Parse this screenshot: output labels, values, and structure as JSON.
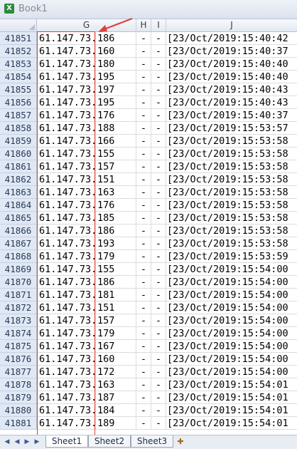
{
  "window": {
    "title": "Book1"
  },
  "columns": [
    "G",
    "H",
    "I",
    "J"
  ],
  "rows": [
    {
      "num": "41851",
      "ip": "61.147.73.",
      "oct": "186",
      "h": "-",
      "i": "-",
      "time": "[23/Oct/2019:15:40:42"
    },
    {
      "num": "41852",
      "ip": "61.147.73.",
      "oct": "160",
      "h": "-",
      "i": "-",
      "time": "[23/Oct/2019:15:40:37"
    },
    {
      "num": "41853",
      "ip": "61.147.73.",
      "oct": "180",
      "h": "-",
      "i": "-",
      "time": "[23/Oct/2019:15:40:40"
    },
    {
      "num": "41854",
      "ip": "61.147.73.",
      "oct": "195",
      "h": "-",
      "i": "-",
      "time": "[23/Oct/2019:15:40:40"
    },
    {
      "num": "41855",
      "ip": "61.147.73.",
      "oct": "197",
      "h": "-",
      "i": "-",
      "time": "[23/Oct/2019:15:40:43"
    },
    {
      "num": "41856",
      "ip": "61.147.73.",
      "oct": "195",
      "h": "-",
      "i": "-",
      "time": "[23/Oct/2019:15:40:43"
    },
    {
      "num": "41857",
      "ip": "61.147.73.",
      "oct": "176",
      "h": "-",
      "i": "-",
      "time": "[23/Oct/2019:15:40:37"
    },
    {
      "num": "41858",
      "ip": "61.147.73.",
      "oct": "188",
      "h": "-",
      "i": "-",
      "time": "[23/Oct/2019:15:53:57"
    },
    {
      "num": "41859",
      "ip": "61.147.73.",
      "oct": "166",
      "h": "-",
      "i": "-",
      "time": "[23/Oct/2019:15:53:58"
    },
    {
      "num": "41860",
      "ip": "61.147.73.",
      "oct": "155",
      "h": "-",
      "i": "-",
      "time": "[23/Oct/2019:15:53:58"
    },
    {
      "num": "41861",
      "ip": "61.147.73.",
      "oct": "157",
      "h": "-",
      "i": "-",
      "time": "[23/Oct/2019:15:53:58"
    },
    {
      "num": "41862",
      "ip": "61.147.73.",
      "oct": "151",
      "h": "-",
      "i": "-",
      "time": "[23/Oct/2019:15:53:58"
    },
    {
      "num": "41863",
      "ip": "61.147.73.",
      "oct": "163",
      "h": "-",
      "i": "-",
      "time": "[23/Oct/2019:15:53:58"
    },
    {
      "num": "41864",
      "ip": "61.147.73.",
      "oct": "176",
      "h": "-",
      "i": "-",
      "time": "[23/Oct/2019:15:53:58"
    },
    {
      "num": "41865",
      "ip": "61.147.73.",
      "oct": "185",
      "h": "-",
      "i": "-",
      "time": "[23/Oct/2019:15:53:58"
    },
    {
      "num": "41866",
      "ip": "61.147.73.",
      "oct": "186",
      "h": "-",
      "i": "-",
      "time": "[23/Oct/2019:15:53:58"
    },
    {
      "num": "41867",
      "ip": "61.147.73.",
      "oct": "193",
      "h": "-",
      "i": "-",
      "time": "[23/Oct/2019:15:53:58"
    },
    {
      "num": "41868",
      "ip": "61.147.73.",
      "oct": "179",
      "h": "-",
      "i": "-",
      "time": "[23/Oct/2019:15:53:59"
    },
    {
      "num": "41869",
      "ip": "61.147.73.",
      "oct": "155",
      "h": "-",
      "i": "-",
      "time": "[23/Oct/2019:15:54:00"
    },
    {
      "num": "41870",
      "ip": "61.147.73.",
      "oct": "186",
      "h": "-",
      "i": "-",
      "time": "[23/Oct/2019:15:54:00"
    },
    {
      "num": "41871",
      "ip": "61.147.73.",
      "oct": "181",
      "h": "-",
      "i": "-",
      "time": "[23/Oct/2019:15:54:00"
    },
    {
      "num": "41872",
      "ip": "61.147.73.",
      "oct": "151",
      "h": "-",
      "i": "-",
      "time": "[23/Oct/2019:15:54:00"
    },
    {
      "num": "41873",
      "ip": "61.147.73.",
      "oct": "157",
      "h": "-",
      "i": "-",
      "time": "[23/Oct/2019:15:54:00"
    },
    {
      "num": "41874",
      "ip": "61.147.73.",
      "oct": "179",
      "h": "-",
      "i": "-",
      "time": "[23/Oct/2019:15:54:00"
    },
    {
      "num": "41875",
      "ip": "61.147.73.",
      "oct": "167",
      "h": "-",
      "i": "-",
      "time": "[23/Oct/2019:15:54:00"
    },
    {
      "num": "41876",
      "ip": "61.147.73.",
      "oct": "160",
      "h": "-",
      "i": "-",
      "time": "[23/Oct/2019:15:54:00"
    },
    {
      "num": "41877",
      "ip": "61.147.73.",
      "oct": "172",
      "h": "-",
      "i": "-",
      "time": "[23/Oct/2019:15:54:00"
    },
    {
      "num": "41878",
      "ip": "61.147.73.",
      "oct": "163",
      "h": "-",
      "i": "-",
      "time": "[23/Oct/2019:15:54:01"
    },
    {
      "num": "41879",
      "ip": "61.147.73.",
      "oct": "187",
      "h": "-",
      "i": "-",
      "time": "[23/Oct/2019:15:54:01"
    },
    {
      "num": "41880",
      "ip": "61.147.73.",
      "oct": "184",
      "h": "-",
      "i": "-",
      "time": "[23/Oct/2019:15:54:01"
    },
    {
      "num": "41881",
      "ip": "61.147.73.",
      "oct": "189",
      "h": "-",
      "i": "-",
      "time": "[23/Oct/2019:15:54:01"
    }
  ],
  "sheet_tabs": [
    "Sheet1",
    "Sheet2",
    "Sheet3"
  ],
  "colors": {
    "highlight": "#e0403a",
    "row_header_bg": "#dfe8f4"
  }
}
